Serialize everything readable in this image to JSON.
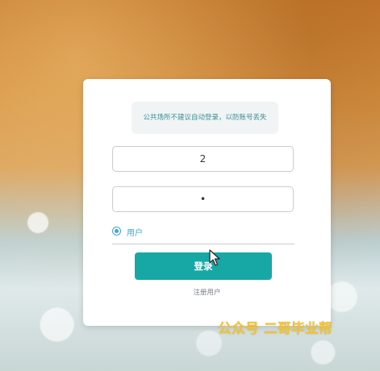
{
  "notice": {
    "text": "公共场所不建议自动登录，以防账号丢失"
  },
  "form": {
    "username_value": "2",
    "password_value": "•",
    "role_label": "用户",
    "login_label": "登录",
    "register_label": "注册用户"
  },
  "watermark": {
    "text": "公众号 二哥毕业帮"
  },
  "colors": {
    "accent": "#17a8a6",
    "radio": "#3fa7c8",
    "watermark": "#f2c230"
  }
}
